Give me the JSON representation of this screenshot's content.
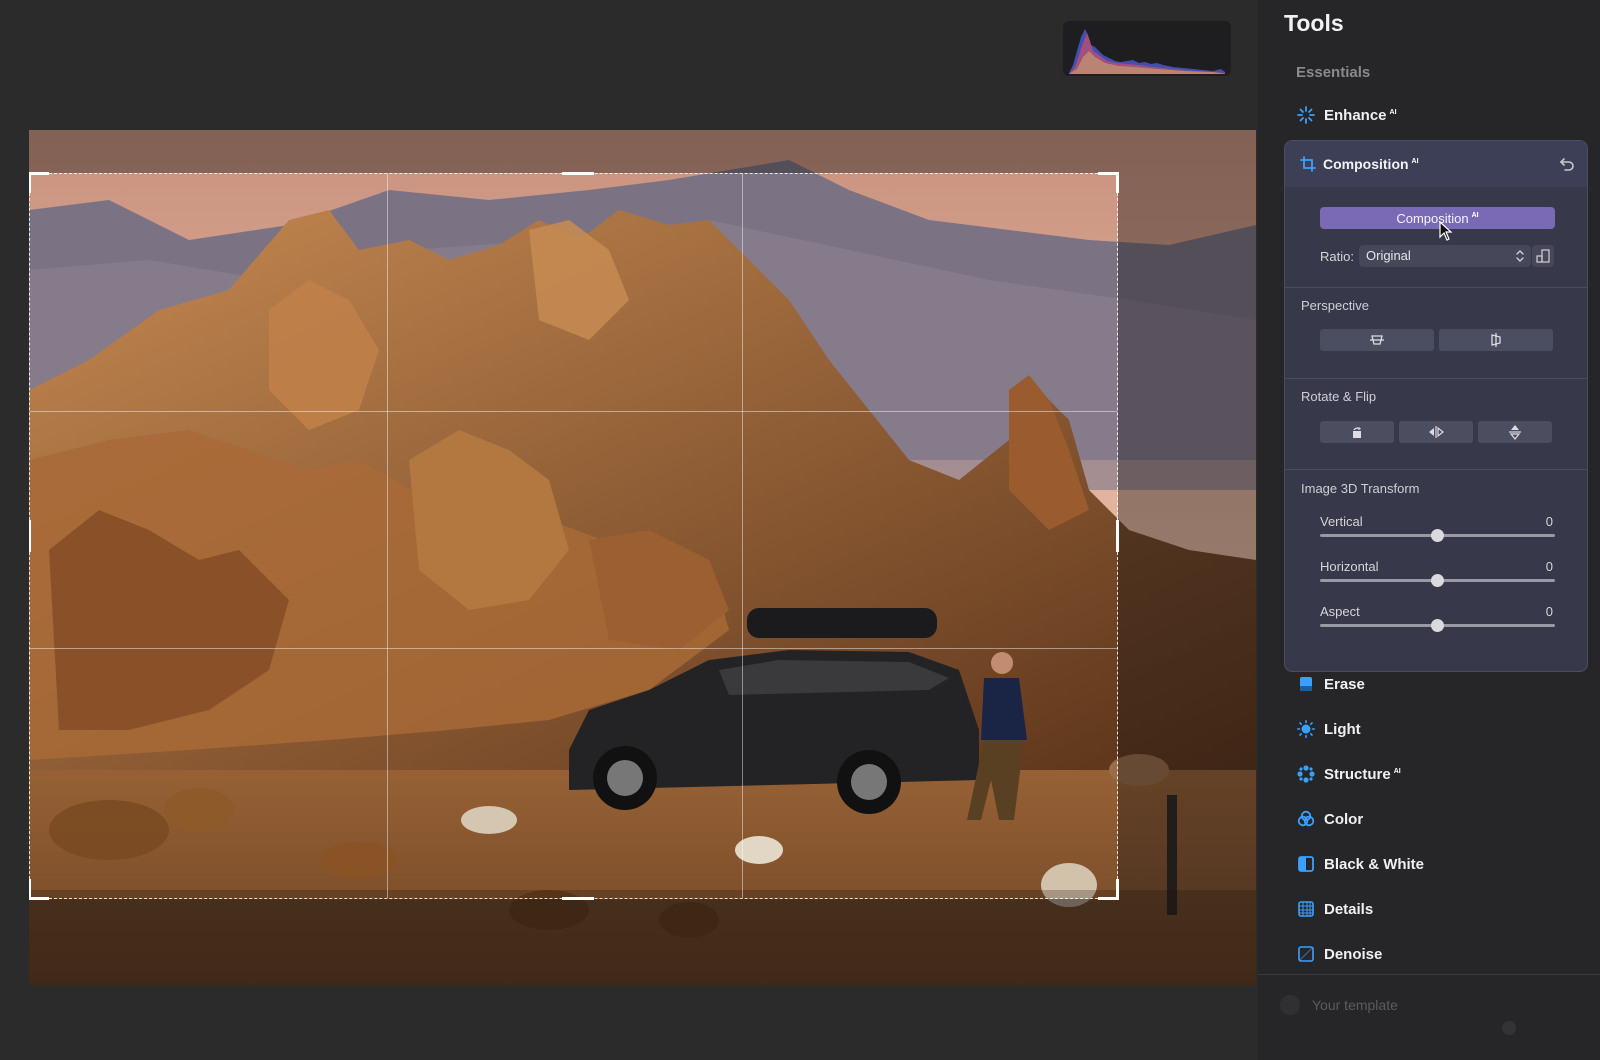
{
  "histogram": {
    "name": "histogram"
  },
  "panel": {
    "title": "Tools",
    "section": "Essentials",
    "ai_badge": "AI",
    "tools_top": [
      {
        "key": "enhance",
        "label": "Enhance",
        "ai": true,
        "icon": "sparkle-icon"
      }
    ],
    "composition": {
      "label": "Composition",
      "icon": "crop-icon",
      "undo_icon": "undo-icon",
      "ai_button": "Composition",
      "ratio_label": "Ratio:",
      "ratio_value": "Original",
      "perspective": "Perspective",
      "rotate_flip": "Rotate & Flip",
      "transform": "Image 3D Transform",
      "sliders": [
        {
          "label": "Vertical",
          "value": 0
        },
        {
          "label": "Horizontal",
          "value": 0
        },
        {
          "label": "Aspect",
          "value": 0
        }
      ]
    },
    "tools_bottom": [
      {
        "key": "erase",
        "label": "Erase",
        "ai": false,
        "icon": "eraser-icon"
      },
      {
        "key": "light",
        "label": "Light",
        "ai": false,
        "icon": "sun-icon"
      },
      {
        "key": "structure",
        "label": "Structure",
        "ai": true,
        "icon": "structure-icon"
      },
      {
        "key": "color",
        "label": "Color",
        "ai": false,
        "icon": "color-wheel-icon"
      },
      {
        "key": "black_white",
        "label": "Black & White",
        "ai": false,
        "icon": "black-white-icon"
      },
      {
        "key": "details",
        "label": "Details",
        "ai": false,
        "icon": "details-grid-icon"
      },
      {
        "key": "denoise",
        "label": "Denoise",
        "ai": false,
        "icon": "denoise-icon"
      }
    ],
    "template": "Your template"
  },
  "colors": {
    "accent": "#3aa0ff",
    "button_purple": "#7a6ab6",
    "panel_bg": "#262628",
    "card_bg": "#37384a"
  }
}
